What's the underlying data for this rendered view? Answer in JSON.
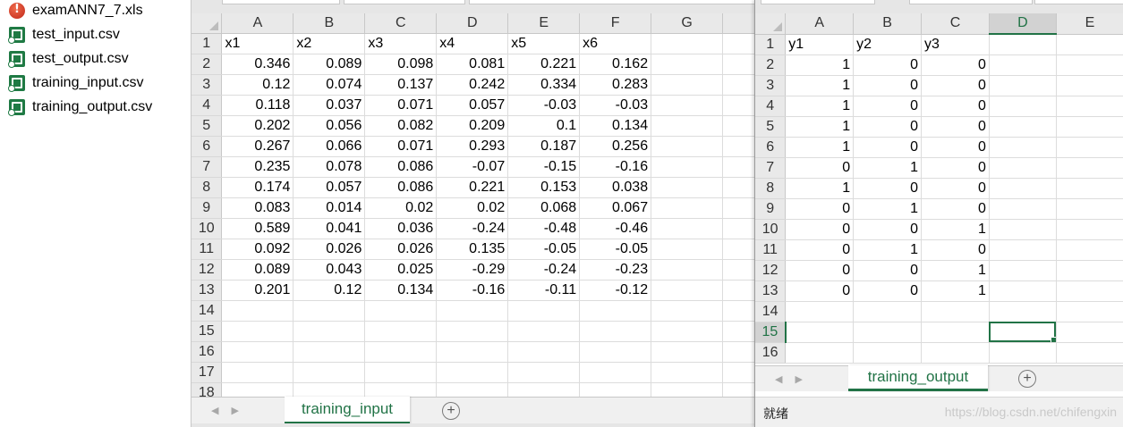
{
  "files": [
    {
      "name": "examANN7_7.xls",
      "icon": "excel-xls-icon"
    },
    {
      "name": "test_input.csv",
      "icon": "csv-file-icon"
    },
    {
      "name": "test_output.csv",
      "icon": "csv-file-icon"
    },
    {
      "name": "training_input.csv",
      "icon": "csv-file-icon"
    },
    {
      "name": "training_output.csv",
      "icon": "csv-file-icon"
    }
  ],
  "left_sheet": {
    "columns": [
      "A",
      "B",
      "C",
      "D",
      "E",
      "F",
      "G"
    ],
    "row_numbers": [
      "1",
      "2",
      "3",
      "4",
      "5",
      "6",
      "7",
      "8",
      "9",
      "10",
      "11",
      "12",
      "13",
      "14",
      "15",
      "16",
      "17",
      "18"
    ],
    "headers": [
      "x1",
      "x2",
      "x3",
      "x4",
      "x5",
      "x6"
    ],
    "rows": [
      [
        "0.346",
        "0.089",
        "0.098",
        "0.081",
        "0.221",
        "0.162"
      ],
      [
        "0.12",
        "0.074",
        "0.137",
        "0.242",
        "0.334",
        "0.283"
      ],
      [
        "0.118",
        "0.037",
        "0.071",
        "0.057",
        "-0.03",
        "-0.03"
      ],
      [
        "0.202",
        "0.056",
        "0.082",
        "0.209",
        "0.1",
        "0.134"
      ],
      [
        "0.267",
        "0.066",
        "0.071",
        "0.293",
        "0.187",
        "0.256"
      ],
      [
        "0.235",
        "0.078",
        "0.086",
        "-0.07",
        "-0.15",
        "-0.16"
      ],
      [
        "0.174",
        "0.057",
        "0.086",
        "0.221",
        "0.153",
        "0.038"
      ],
      [
        "0.083",
        "0.014",
        "0.02",
        "0.02",
        "0.068",
        "0.067"
      ],
      [
        "0.589",
        "0.041",
        "0.036",
        "-0.24",
        "-0.48",
        "-0.46"
      ],
      [
        "0.092",
        "0.026",
        "0.026",
        "0.135",
        "-0.05",
        "-0.05"
      ],
      [
        "0.089",
        "0.043",
        "0.025",
        "-0.29",
        "-0.24",
        "-0.23"
      ],
      [
        "0.201",
        "0.12",
        "0.134",
        "-0.16",
        "-0.11",
        "-0.12"
      ]
    ],
    "tab": "training_input",
    "add_symbol": "+"
  },
  "right_sheet": {
    "columns": [
      "A",
      "B",
      "C",
      "D",
      "E"
    ],
    "row_numbers": [
      "1",
      "2",
      "3",
      "4",
      "5",
      "6",
      "7",
      "8",
      "9",
      "10",
      "11",
      "12",
      "13",
      "14",
      "15",
      "16"
    ],
    "headers": [
      "y1",
      "y2",
      "y3"
    ],
    "rows": [
      [
        "1",
        "0",
        "0"
      ],
      [
        "1",
        "0",
        "0"
      ],
      [
        "1",
        "0",
        "0"
      ],
      [
        "1",
        "0",
        "0"
      ],
      [
        "1",
        "0",
        "0"
      ],
      [
        "0",
        "1",
        "0"
      ],
      [
        "1",
        "0",
        "0"
      ],
      [
        "0",
        "1",
        "0"
      ],
      [
        "0",
        "0",
        "1"
      ],
      [
        "0",
        "1",
        "0"
      ],
      [
        "0",
        "0",
        "1"
      ],
      [
        "0",
        "0",
        "1"
      ]
    ],
    "selected_column": "D",
    "selected_row": "15",
    "tab": "training_output",
    "add_symbol": "+",
    "status": "就绪",
    "watermark": "https://blog.csdn.net/chifengxin"
  },
  "colors": {
    "accent": "#217346",
    "header_bg": "#e9e9e9",
    "gridline": "#dcdcdc"
  }
}
